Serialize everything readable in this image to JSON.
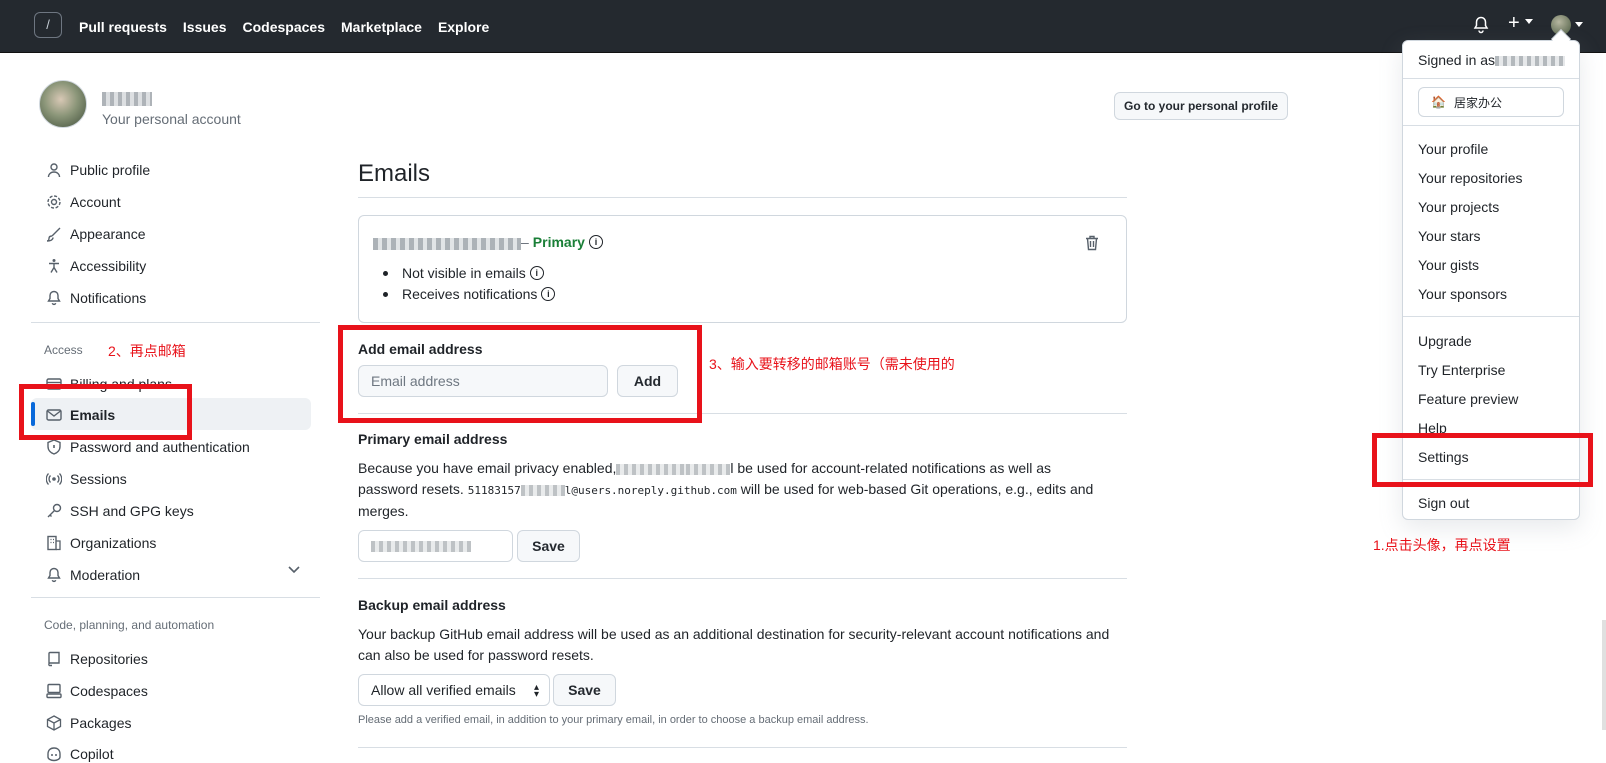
{
  "header": {
    "slash": "/",
    "nav": [
      "Pull requests",
      "Issues",
      "Codespaces",
      "Marketplace",
      "Explore"
    ],
    "icons": [
      "bell-icon",
      "plus-icon",
      "avatar"
    ]
  },
  "profile": {
    "subtitle": "Your personal account",
    "go_profile_button": "Go to your personal profile"
  },
  "sidebar": {
    "items": [
      {
        "label": "Public profile",
        "icon": "person-icon"
      },
      {
        "label": "Account",
        "icon": "gear-icon"
      },
      {
        "label": "Appearance",
        "icon": "paintbrush-icon"
      },
      {
        "label": "Accessibility",
        "icon": "accessibility-icon"
      },
      {
        "label": "Notifications",
        "icon": "bell-icon"
      }
    ],
    "access_heading": "Access",
    "access_items": [
      {
        "label": "Billing and plans",
        "icon": "credit-card-icon"
      },
      {
        "label": "Emails",
        "icon": "mail-icon"
      },
      {
        "label": "Password and authentication",
        "icon": "shield-lock-icon"
      },
      {
        "label": "Sessions",
        "icon": "broadcast-icon"
      },
      {
        "label": "SSH and GPG keys",
        "icon": "key-icon"
      },
      {
        "label": "Organizations",
        "icon": "organization-icon"
      },
      {
        "label": "Moderation",
        "icon": "bell-slash-icon"
      }
    ],
    "code_heading": "Code, planning, and automation",
    "code_items": [
      {
        "label": "Repositories",
        "icon": "repo-icon"
      },
      {
        "label": "Codespaces",
        "icon": "codespaces-icon"
      },
      {
        "label": "Packages",
        "icon": "package-icon"
      },
      {
        "label": "Copilot",
        "icon": "copilot-icon"
      }
    ]
  },
  "main": {
    "title": "Emails",
    "primary_label": "Primary",
    "bullets": [
      "Not visible in emails",
      "Receives notifications"
    ],
    "add_email": {
      "heading": "Add email address",
      "placeholder": "Email address",
      "button": "Add"
    },
    "primary_email": {
      "heading": "Primary email address",
      "text_a": "Because you have email privacy enabled,",
      "text_b": "l be used for account-related notifications as well as",
      "text_c": "password resets.",
      "mono_a": "51183157",
      "mono_b": "l@users.noreply.github.com",
      "text_d": "will be used for web-based Git operations, e.g., edits and",
      "text_e": "merges.",
      "save": "Save"
    },
    "backup_email": {
      "heading": "Backup email address",
      "text": "Your backup GitHub email address will be used as an additional destination for security-relevant account notifications and can also be used for password resets.",
      "select_value": "Allow all verified emails",
      "save": "Save",
      "note": "Please add a verified email, in addition to your primary email, in order to choose a backup email address."
    }
  },
  "dropdown": {
    "signed_in": "Signed in as",
    "status": "居家办公",
    "status_icon": "house-emoji-icon",
    "group1": [
      "Your profile",
      "Your repositories",
      "Your projects",
      "Your stars",
      "Your gists",
      "Your sponsors"
    ],
    "group2": [
      "Upgrade",
      "Try Enterprise",
      "Feature preview",
      "Help",
      "Settings"
    ],
    "signout": "Sign out"
  },
  "annotations": {
    "step1": "1.点击头像，再点设置",
    "step2": "2、再点邮箱",
    "step3": "3、输入要转移的邮箱账号（需未使用的",
    "color": "#e8121a"
  }
}
